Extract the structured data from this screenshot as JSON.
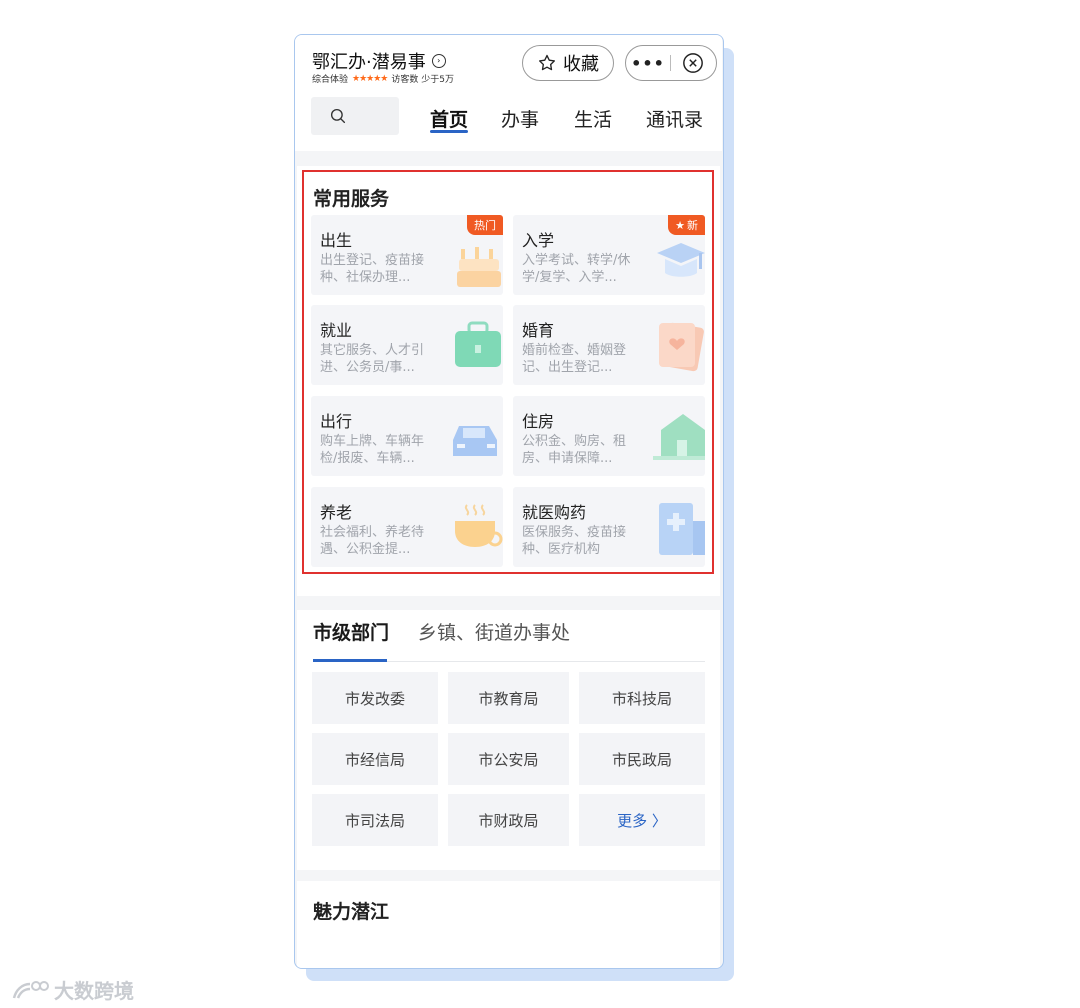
{
  "header": {
    "title": "鄂汇办·潜易事",
    "rating_label": "综合体验",
    "stars": "★★★★★",
    "visitors": "访客数 少于5万",
    "favorite_label": "收藏",
    "more_icon": "more-dots-icon",
    "close_icon": "close-circle-icon"
  },
  "nav": {
    "search_icon": "search-icon",
    "tabs": [
      "首页",
      "办事",
      "生活",
      "通讯录"
    ],
    "active_tab": "首页"
  },
  "services": {
    "title": "常用服务",
    "items": [
      {
        "title": "出生",
        "desc": "出生登记、疫苗接种、社保办理...",
        "tag": "热门",
        "icon": "cake-icon"
      },
      {
        "title": "入学",
        "desc": "入学考试、转学/休学/复学、入学...",
        "tag": "新",
        "icon": "graduation-cap-icon"
      },
      {
        "title": "就业",
        "desc": "其它服务、人才引进、公务员/事...",
        "tag": "",
        "icon": "briefcase-icon"
      },
      {
        "title": "婚育",
        "desc": "婚前检查、婚姻登记、出生登记...",
        "tag": "",
        "icon": "marriage-cert-icon"
      },
      {
        "title": "出行",
        "desc": "购车上牌、车辆年检/报废、车辆...",
        "tag": "",
        "icon": "car-icon"
      },
      {
        "title": "住房",
        "desc": "公积金、购房、租房、申请保障...",
        "tag": "",
        "icon": "house-icon"
      },
      {
        "title": "养老",
        "desc": "社会福利、养老待遇、公积金提...",
        "tag": "",
        "icon": "tea-cup-icon"
      },
      {
        "title": "就医购药",
        "desc": "医保服务、疫苗接种、医疗机构",
        "tag": "",
        "icon": "hospital-icon"
      }
    ]
  },
  "departments": {
    "tabs": [
      "市级部门",
      "乡镇、街道办事处"
    ],
    "items": [
      "市发改委",
      "市教育局",
      "市科技局",
      "市经信局",
      "市公安局",
      "市民政局",
      "市司法局",
      "市财政局"
    ],
    "more_label": "更多 〉"
  },
  "charm": {
    "title": "魅力潜江"
  },
  "watermark": {
    "text": "大数跨境"
  },
  "colors": {
    "accent": "#2a64c5",
    "highlight_frame": "#e0312f",
    "tag_orange": "#f05a23"
  }
}
